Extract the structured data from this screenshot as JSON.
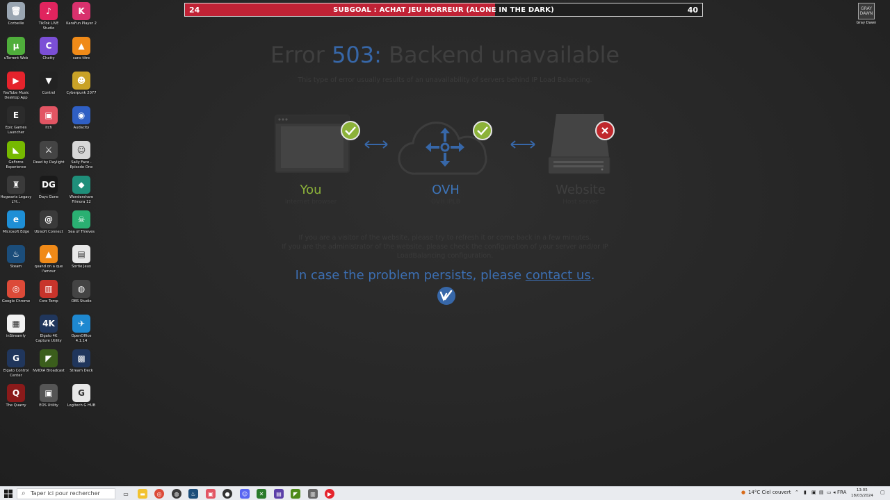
{
  "desktop_icons": [
    {
      "label": "Corbeille",
      "icon": "recycle-bin-icon",
      "color": "#9aa6b2",
      "glyph": "🗑"
    },
    {
      "label": "TikTok LIVE Studio",
      "icon": "tiktok-icon",
      "color": "#e0245e",
      "glyph": "♪"
    },
    {
      "label": "KaraFun Player 2",
      "icon": "karafun-icon",
      "color": "#d8316d",
      "glyph": "K"
    },
    {
      "label": "uTorrent Web",
      "icon": "utorrent-icon",
      "color": "#4fae3b",
      "glyph": "µ"
    },
    {
      "label": "Chatty",
      "icon": "chatty-icon",
      "color": "#7b4fd6",
      "glyph": "C"
    },
    {
      "label": "sans titre",
      "icon": "vlc-icon",
      "color": "#f08a18",
      "glyph": "▲"
    },
    {
      "label": "YouTube Music Desktop App",
      "icon": "youtube-music-icon",
      "color": "#e5232c",
      "glyph": "▶"
    },
    {
      "label": "Control",
      "icon": "control-game-icon",
      "color": "#222222",
      "glyph": "▼"
    },
    {
      "label": "Cyberpunk 2077",
      "icon": "cyberpunk-icon",
      "color": "#c9a227",
      "glyph": "☻"
    },
    {
      "label": "Epic Games Launcher",
      "icon": "epic-games-icon",
      "color": "#2b2b2b",
      "glyph": "E"
    },
    {
      "label": "itch",
      "icon": "itch-icon",
      "color": "#e25563",
      "glyph": "▣"
    },
    {
      "label": "Audacity",
      "icon": "audacity-icon",
      "color": "#2f5fc4",
      "glyph": "◉"
    },
    {
      "label": "GeForce Experience",
      "icon": "geforce-icon",
      "color": "#76b900",
      "glyph": "◣"
    },
    {
      "label": "Dead by Daylight",
      "icon": "dead-by-daylight-icon",
      "color": "#444444",
      "glyph": "⚔"
    },
    {
      "label": "Sally Face - Episode One",
      "icon": "sally-face-icon",
      "color": "#d7d7d7",
      "glyph": "☺"
    },
    {
      "label": "Hogwarts Legacy  L'H...",
      "icon": "hogwarts-icon",
      "color": "#3a3a3a",
      "glyph": "♜"
    },
    {
      "label": "Days Gone",
      "icon": "days-gone-icon",
      "color": "#1a1a1a",
      "glyph": "DG"
    },
    {
      "label": "Wondershare Filmora 12",
      "icon": "filmora-icon",
      "color": "#1f8f7a",
      "glyph": "◆"
    },
    {
      "label": "Microsoft Edge",
      "icon": "edge-icon",
      "color": "#1e8fd6",
      "glyph": "e"
    },
    {
      "label": "Ubisoft Connect",
      "icon": "ubisoft-icon",
      "color": "#3a3a3a",
      "glyph": "@"
    },
    {
      "label": "Sea of Thieves",
      "icon": "sea-of-thieves-icon",
      "color": "#2ab072",
      "glyph": "☠"
    },
    {
      "label": "Steam",
      "icon": "steam-icon",
      "color": "#1b4d7a",
      "glyph": "♨"
    },
    {
      "label": "quand on a que l'amour",
      "icon": "vlc-icon",
      "color": "#f08a18",
      "glyph": "▲"
    },
    {
      "label": "Sortie Jeux",
      "icon": "document-icon",
      "color": "#e8e8e8",
      "glyph": "▤"
    },
    {
      "label": "Google Chrome",
      "icon": "chrome-icon",
      "color": "#dc4a38",
      "glyph": "◎"
    },
    {
      "label": "Core Temp",
      "icon": "core-temp-icon",
      "color": "#c8342b",
      "glyph": "▥"
    },
    {
      "label": "OBS Studio",
      "icon": "obs-icon",
      "color": "#444444",
      "glyph": "◍"
    },
    {
      "label": "inStreamly",
      "icon": "instreamly-icon",
      "color": "#f2f2f2",
      "glyph": "▦"
    },
    {
      "label": "Elgato 4K Capture Utility",
      "icon": "elgato-4k-icon",
      "color": "#20365c",
      "glyph": "4K"
    },
    {
      "label": "OpenOffice 4.1.14",
      "icon": "openoffice-icon",
      "color": "#1e88d0",
      "glyph": "✈"
    },
    {
      "label": "Elgato Control Center",
      "icon": "elgato-control-icon",
      "color": "#20365c",
      "glyph": "G"
    },
    {
      "label": "NVIDIA Broadcast",
      "icon": "nvidia-broadcast-icon",
      "color": "#3b5e1c",
      "glyph": "◤"
    },
    {
      "label": "Stream Deck",
      "icon": "stream-deck-icon",
      "color": "#20365c",
      "glyph": "▩"
    },
    {
      "label": "The Quarry",
      "icon": "the-quarry-icon",
      "color": "#8a1a1a",
      "glyph": "Q"
    },
    {
      "label": "EOS Utility",
      "icon": "eos-utility-icon",
      "color": "#555555",
      "glyph": "▣"
    },
    {
      "label": "Logitech G HUB",
      "icon": "logitech-ghub-icon",
      "color": "#e8e8e8",
      "glyph": "G"
    }
  ],
  "subgoal": {
    "current": "24",
    "target": "40",
    "title": "SUBGOAL : ACHAT JEU HORREUR (ALONE IN THE DARK)",
    "progress_fraction": 0.6,
    "fill_color": "#c02235"
  },
  "corner_icon": {
    "label": "Gray Dawn",
    "art": "GRAY DAWN"
  },
  "error_page": {
    "title_prefix": "Error ",
    "code": "503:",
    "title_suffix": " Backend unavailable",
    "subtitle": "This type of error usually results of an unavailability of servers behind IP Load Balancing.",
    "nodes": {
      "you": {
        "name": "You",
        "desc": "Internet browser",
        "status": "ok"
      },
      "ovh": {
        "name": "OVH",
        "desc": "OVH IPLB",
        "status": "ok"
      },
      "website": {
        "name": "Website",
        "desc": "Host server",
        "status": "error"
      }
    },
    "info_line_1": "If you are a visitor of the website, please try to refresh it or come back in a few minutes.",
    "info_line_2": "If you are the administrator of the website, please check the configuration of your server and/or IP",
    "info_line_3": "LoadBalancing configuration.",
    "persist_text": "In case the problem persists, please ",
    "contact_link": "contact us",
    "persist_end": ".",
    "ok_color": "#8cb23a",
    "error_color": "#c0282c",
    "accent_color": "#3767a8"
  },
  "taskbar": {
    "search_placeholder": "Taper ici pour rechercher",
    "weather": "14°C  Ciel couvert",
    "language": "FRA",
    "time": "13:05",
    "date": "18/03/2024"
  }
}
